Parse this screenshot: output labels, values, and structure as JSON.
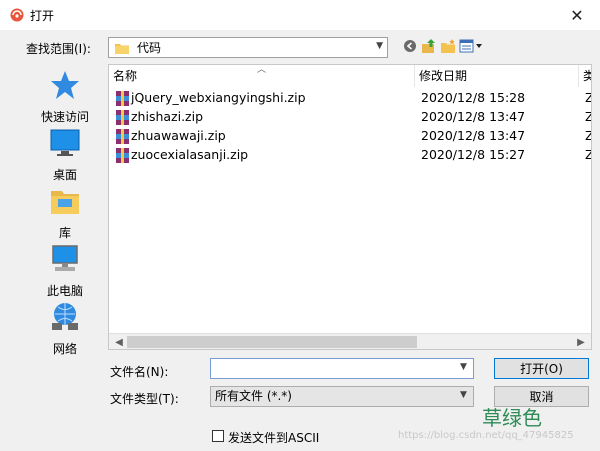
{
  "window": {
    "title": "打开",
    "close_glyph": "✕"
  },
  "lookin": {
    "label": "查找范围(I):",
    "value": "代码"
  },
  "places": [
    {
      "label": "快速访问",
      "icon": "star-icon"
    },
    {
      "label": "桌面",
      "icon": "desktop-icon"
    },
    {
      "label": "库",
      "icon": "library-icon"
    },
    {
      "label": "此电脑",
      "icon": "computer-icon"
    },
    {
      "label": "网络",
      "icon": "network-icon"
    }
  ],
  "columns": {
    "name": "名称",
    "date": "修改日期",
    "type": "类"
  },
  "files": [
    {
      "name": "jQuery_webxiangyingshi.zip",
      "date": "2020/12/8 15:28",
      "type": "Z"
    },
    {
      "name": "zhishazi.zip",
      "date": "2020/12/8 13:47",
      "type": "Z"
    },
    {
      "name": "zhuawawaji.zip",
      "date": "2020/12/8 13:47",
      "type": "Z"
    },
    {
      "name": "zuocexialasanji.zip",
      "date": "2020/12/8 15:27",
      "type": "Z"
    }
  ],
  "filename": {
    "label": "文件名(N):",
    "value": ""
  },
  "filetype": {
    "label": "文件类型(T):",
    "value": "所有文件 (*.*)"
  },
  "buttons": {
    "open": "打开(O)",
    "cancel": "取消"
  },
  "ascii": {
    "label": "发送文件到ASCII",
    "checked": false
  },
  "watermark": {
    "text": "草绿色",
    "url": "https://blog.csdn.net/qq_47945825"
  },
  "colors": {
    "accent": "#0078d7",
    "watermark": "#2e8b57"
  }
}
